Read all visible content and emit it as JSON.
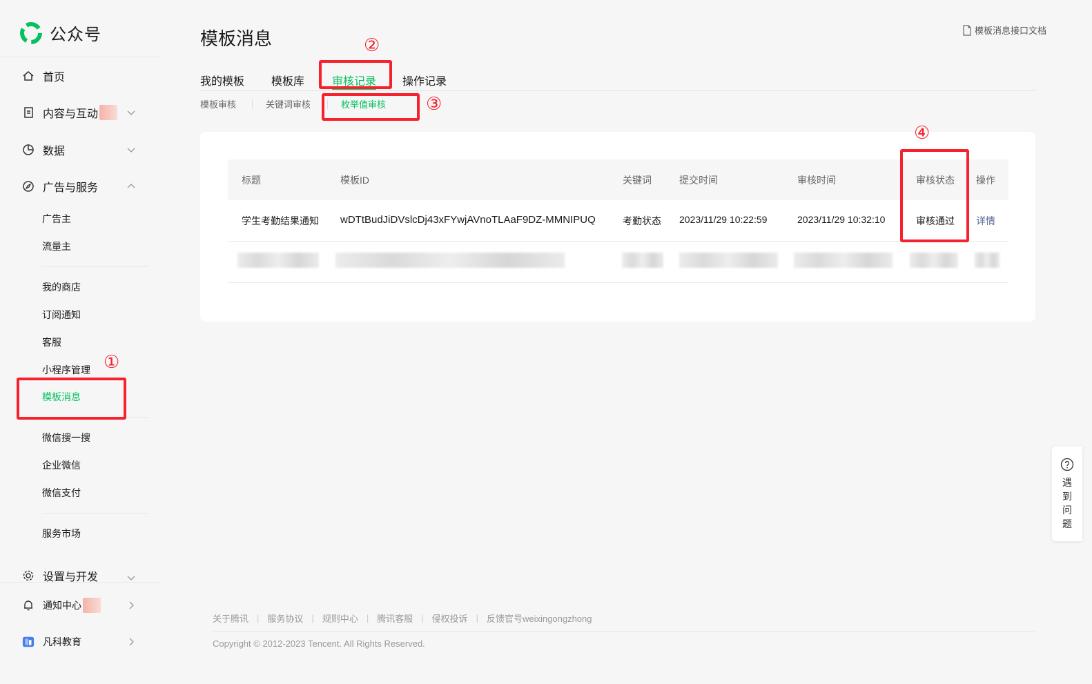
{
  "brand": {
    "name": "公众号"
  },
  "sidebar": {
    "home": "首页",
    "content": "内容与互动",
    "data": "数据",
    "ads": "广告与服务",
    "ads_sub": [
      "广告主",
      "流量主"
    ],
    "group2": [
      "我的商店",
      "订阅通知",
      "客服",
      "小程序管理",
      "模板消息"
    ],
    "group3": [
      "微信搜一搜",
      "企业微信",
      "微信支付"
    ],
    "market": "服务市场",
    "settings": "设置与开发",
    "notify": "通知中心",
    "account": "凡科教育"
  },
  "header": {
    "title": "模板消息",
    "doc_link": "模板消息接口文档"
  },
  "tabs": [
    "我的模板",
    "模板库",
    "审核记录",
    "操作记录"
  ],
  "subtabs": [
    "模板审核",
    "关键词审核",
    "枚举值审核"
  ],
  "table": {
    "columns": [
      "标题",
      "模板ID",
      "关键词",
      "提交时间",
      "审核时间",
      "审核状态",
      "操作"
    ],
    "rows": [
      {
        "title": "学生考勤结果通知",
        "template_id": "wDTtBudJiDVslcDj43xFYwjAVnoTLAaF9DZ-MMNIPUQ",
        "keyword": "考勤状态",
        "submit_time": "2023/11/29 10:22:59",
        "review_time": "2023/11/29 10:32:10",
        "status": "审核通过",
        "action": "详情"
      }
    ]
  },
  "annotations": [
    "①",
    "②",
    "③",
    "④"
  ],
  "help": {
    "label": "遇到问题"
  },
  "footer": {
    "links": [
      "关于腾讯",
      "服务协议",
      "规则中心",
      "腾讯客服",
      "侵权投诉",
      "反馈官号weixingongzhong"
    ],
    "copyright": "Copyright © 2012-2023 Tencent. All Rights Reserved."
  },
  "colors": {
    "accent": "#07c160",
    "annotation": "#f5222d",
    "link": "#576b95"
  }
}
